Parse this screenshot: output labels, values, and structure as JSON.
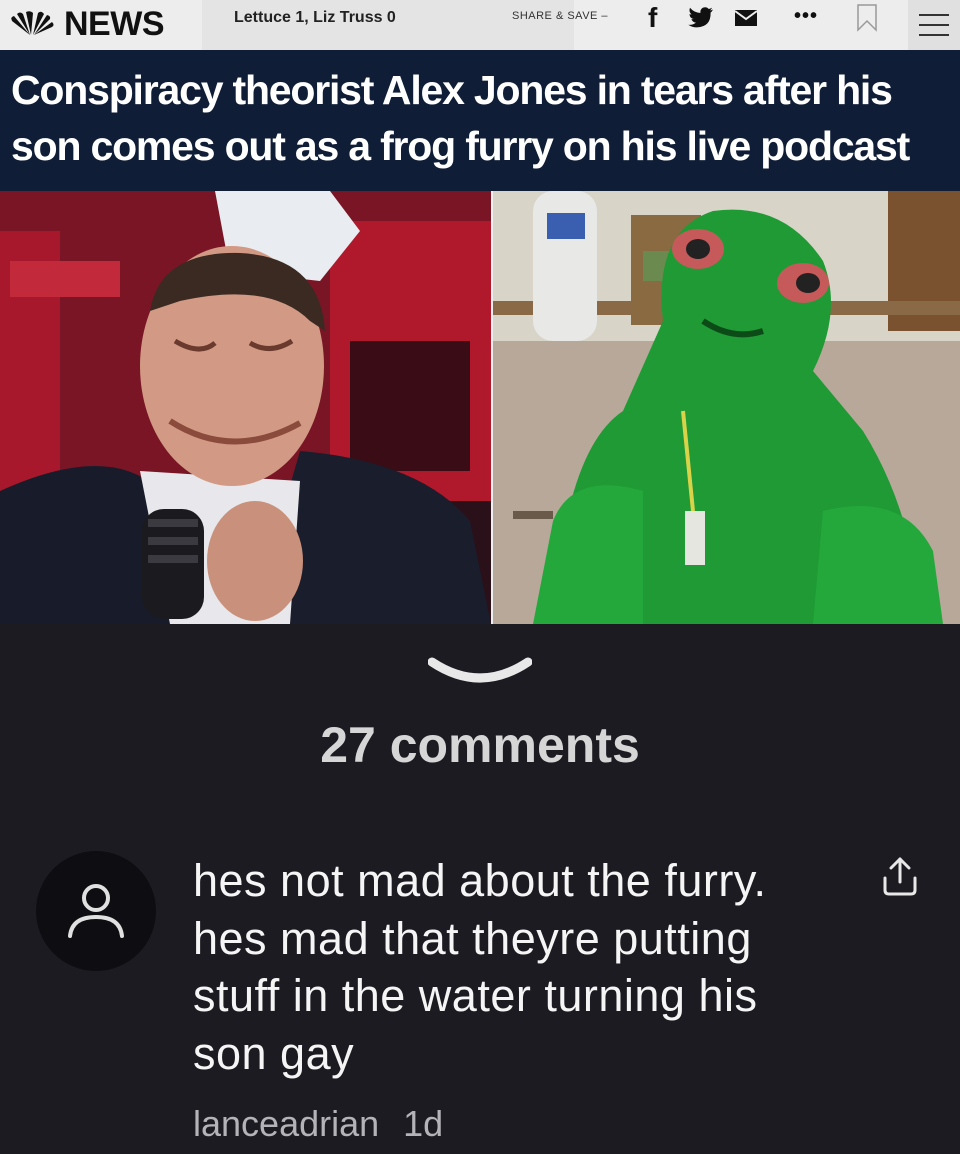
{
  "header": {
    "logo_text": "NEWS",
    "ticker": "Lettuce 1, Liz Truss 0",
    "share_save": "SHARE & SAVE –",
    "social_icons": [
      "facebook-icon",
      "twitter-icon",
      "mail-icon"
    ],
    "more_label": "•••",
    "bookmark_icon": "bookmark-icon",
    "menu_icon": "hamburger-menu-icon"
  },
  "article": {
    "headline": "Conspiracy theorist Alex Jones in tears after his son comes out as a frog furry on his live podcast",
    "images": [
      {
        "name": "crying-man-photo"
      },
      {
        "name": "frog-costume-photo"
      }
    ]
  },
  "comments": {
    "count_label": "27 comments",
    "items": [
      {
        "text": "hes not mad about the furry. hes mad that theyre putting stuff in the water turning his son gay",
        "author": "lanceadrian",
        "age": "1d"
      }
    ]
  },
  "colors": {
    "page_bg": "#1c1b21",
    "headline_bg": "#0f1d36",
    "topbar_bg": "#ededed"
  }
}
